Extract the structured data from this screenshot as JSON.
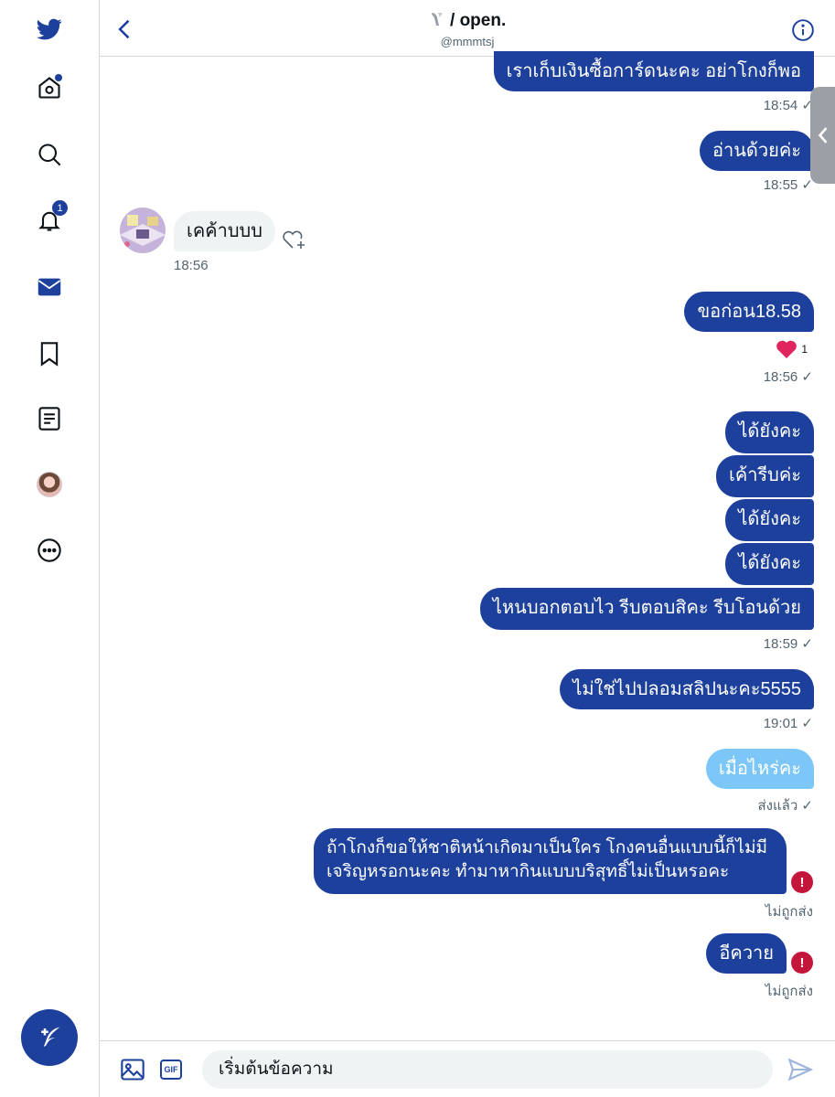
{
  "header": {
    "title": "/ open.",
    "handle": "@mmmtsj"
  },
  "sidebar": {
    "notification_count": "1"
  },
  "messages": {
    "m1": {
      "text": "เราเก็บเงินซื้อการ์ดนะคะ อย่าโกงก็พอ",
      "time": "18:54 ✓"
    },
    "m2": {
      "text": "อ่านด้วยค่ะ",
      "time": "18:55 ✓"
    },
    "m3": {
      "text": "เคค้าบบบ",
      "time": "18:56"
    },
    "m4": {
      "text": "ขอก่อน18.58",
      "reaction_count": "1",
      "time": "18:56 ✓"
    },
    "m5": {
      "text": "ได้ยังคะ"
    },
    "m6": {
      "text": "เค้ารีบค่ะ"
    },
    "m7": {
      "text": "ได้ยังคะ"
    },
    "m8": {
      "text": "ได้ยังคะ"
    },
    "m9": {
      "text": "ไหนบอกตอบไว รีบตอบสิคะ รีบโอนด้วย",
      "time": "18:59 ✓"
    },
    "m10": {
      "text": "ไม่ใช่ไปปลอมสลิปนะคะ5555",
      "time": "19:01 ✓"
    },
    "m11": {
      "text": "เมื่อไหร่คะ",
      "status": "ส่งแล้ว ✓"
    },
    "m12": {
      "line1": "ถ้าโกงก็ขอให้ชาติหน้าเกิดมาเป็นใคร โกงคนอื่นแบบนี้ก็ไม่มี",
      "line2": "เจริญหรอกนะคะ ทำมาหากินแบบบริสุทธิ์ไม่เป็นหรอคะ",
      "status": "ไม่ถูกส่ง"
    },
    "m13": {
      "text": "อีควาย",
      "status": "ไม่ถูกส่ง"
    }
  },
  "composer": {
    "placeholder": "เริ่มต้นข้อความ",
    "gif_label": "GIF"
  },
  "colors": {
    "accent": "#1d409c",
    "pending": "#7cc7f7",
    "error": "#c4153a",
    "received_bubble": "#eff3f4"
  },
  "icons": [
    "twitter-logo-icon",
    "home-icon",
    "search-icon",
    "bell-icon",
    "mail-icon",
    "bookmark-icon",
    "list-icon",
    "avatar",
    "more-icon",
    "compose-icon",
    "back-icon",
    "info-icon",
    "heart-plus-icon",
    "heart-icon",
    "error-icon",
    "image-icon",
    "send-icon"
  ]
}
